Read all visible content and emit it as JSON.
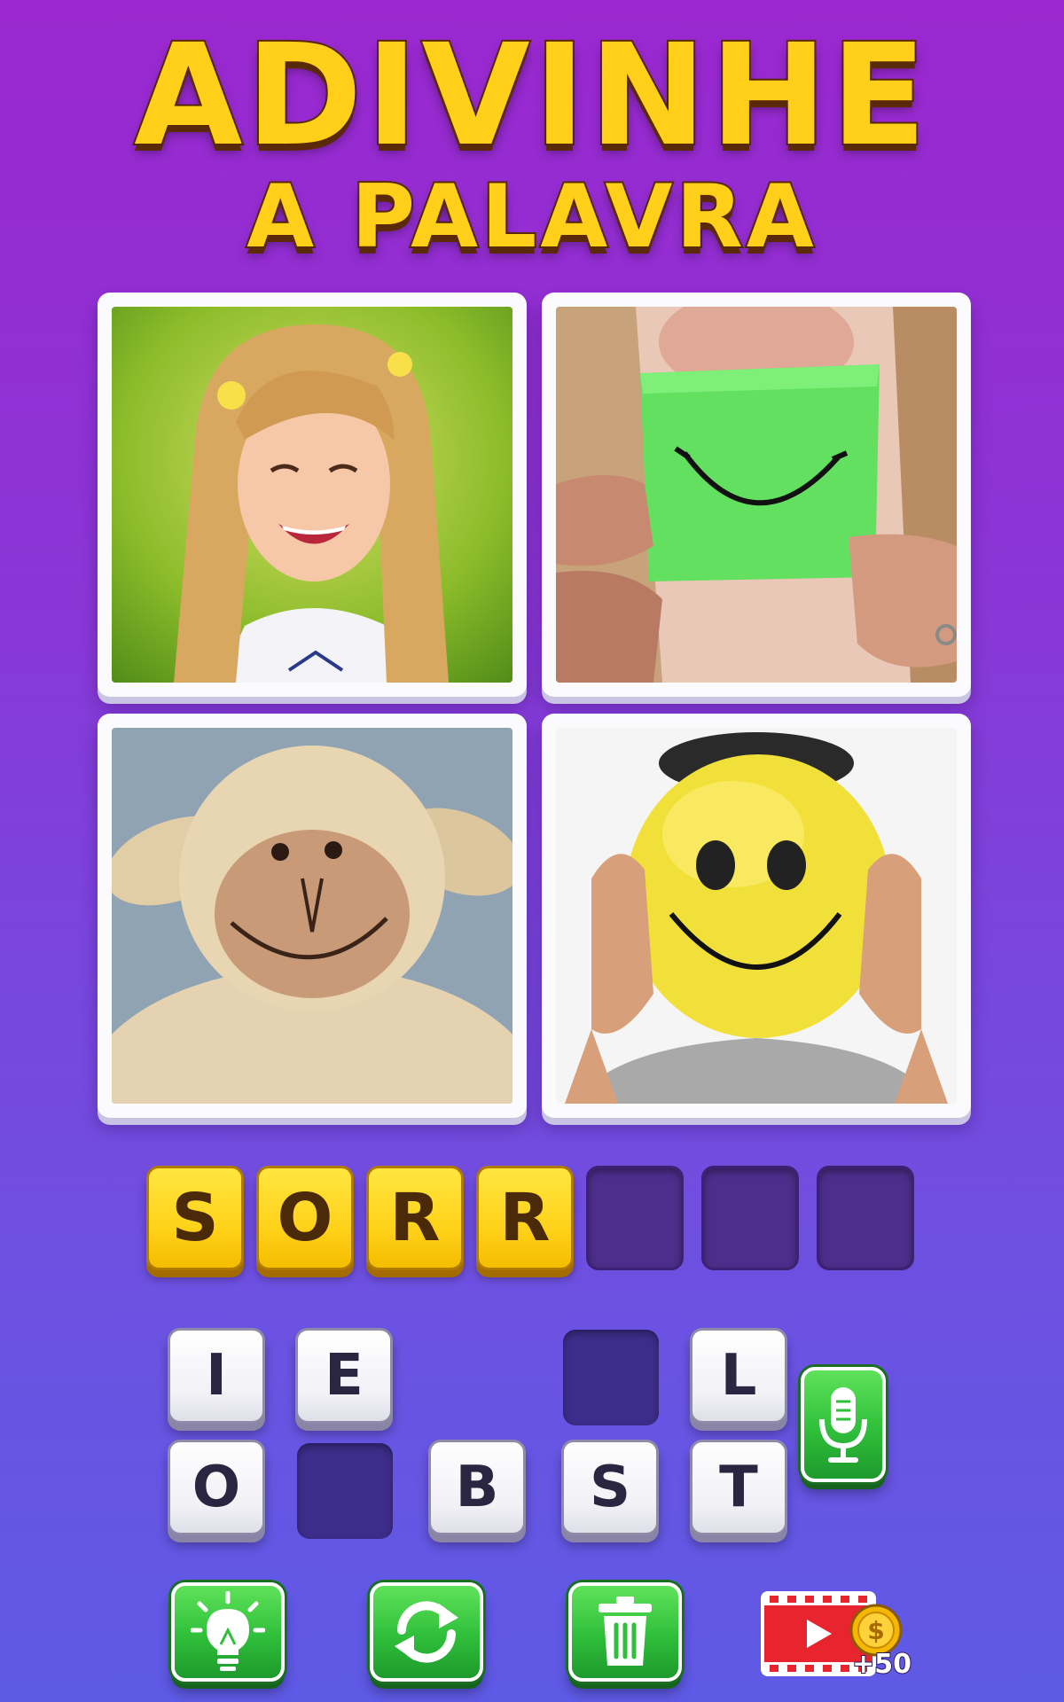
{
  "title": {
    "line1": "ADIVINHE",
    "line2": "A PALAVRA"
  },
  "pictures": [
    {
      "icon": "laughing-girl-photo"
    },
    {
      "icon": "paper-smile-photo"
    },
    {
      "icon": "plush-sheep-photo"
    },
    {
      "icon": "smiley-balloon-photo"
    }
  ],
  "answer": {
    "slots": [
      "S",
      "O",
      "R",
      "R",
      "",
      "",
      ""
    ]
  },
  "keyboard": {
    "row1": [
      "I",
      "E",
      "",
      "",
      "L"
    ],
    "row2": [
      "O",
      "",
      "B",
      "S",
      "T"
    ]
  },
  "actions": {
    "hint_icon": "lightbulb-icon",
    "shuffle_icon": "shuffle-icon",
    "delete_icon": "trash-icon",
    "microphone_icon": "microphone-icon",
    "video_icon": "video-play-icon",
    "coin_icon": "coin-icon",
    "bonus_text": "+50"
  },
  "colors": {
    "title_fill": "#ffcf1a",
    "title_outline": "#5a2a08",
    "slot_filled": "#ffd21a",
    "slot_empty": "#4d2e8c",
    "button_green": "#2fbf3a",
    "video_red": "#e8242e",
    "coin_gold": "#f5b800"
  }
}
